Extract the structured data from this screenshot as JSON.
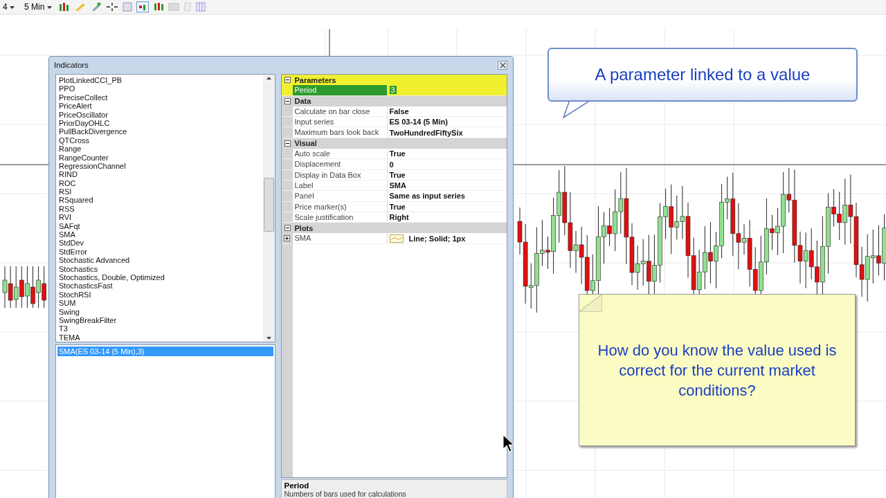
{
  "toolbar": {
    "dropdowns": [
      {
        "label": "4"
      },
      {
        "label": "5 Min"
      }
    ]
  },
  "dialog": {
    "title": "Indicators",
    "indicator_list": [
      "PlotLinkedCCI_PB",
      "PPO",
      "PreciseCollect",
      "PriceAlert",
      "PriceOscillator",
      "PriorDayOHLC",
      "PullBackDivergence",
      "QTCross",
      "Range",
      "RangeCounter",
      "RegressionChannel",
      "RIND",
      "ROC",
      "RSI",
      "RSquared",
      "RSS",
      "RVI",
      "SAFqt",
      "SMA",
      "StdDev",
      "StdError",
      "Stochastic Advanced",
      "Stochastics",
      "Stochastics, Double, Optimized",
      "StochasticsFast",
      "StochRSI",
      "SUM",
      "Swing",
      "SwingBreakFilter",
      "T3",
      "TEMA"
    ],
    "applied": [
      {
        "label": "SMA(ES 03-14 (5 Min),3)",
        "selected": true
      }
    ],
    "property_groups": [
      {
        "name": "Parameters",
        "expanded": true,
        "highlighted": true,
        "rows": [
          {
            "kind": "text",
            "name": "Period",
            "value": "3",
            "selected": true
          }
        ]
      },
      {
        "name": "Data",
        "expanded": true,
        "highlighted": false,
        "rows": [
          {
            "kind": "text",
            "name": "Calculate on bar close",
            "value": "False",
            "selected": false
          },
          {
            "kind": "text",
            "name": "Input series",
            "value": "ES 03-14 (5 Min)",
            "selected": false
          },
          {
            "kind": "text",
            "name": "Maximum bars look back",
            "value": "TwoHundredFiftySix",
            "selected": false
          }
        ]
      },
      {
        "name": "Visual",
        "expanded": true,
        "highlighted": false,
        "rows": [
          {
            "kind": "text",
            "name": "Auto scale",
            "value": "True",
            "selected": false
          },
          {
            "kind": "text",
            "name": "Displacement",
            "value": "0",
            "selected": false
          },
          {
            "kind": "text",
            "name": "Display in Data Box",
            "value": "True",
            "selected": false
          },
          {
            "kind": "text",
            "name": "Label",
            "value": "SMA",
            "selected": false
          },
          {
            "kind": "text",
            "name": "Panel",
            "value": "Same as input series",
            "selected": false
          },
          {
            "kind": "text",
            "name": "Price marker(s)",
            "value": "True",
            "selected": false
          },
          {
            "kind": "text",
            "name": "Scale justification",
            "value": "Right",
            "selected": false
          }
        ]
      },
      {
        "name": "Plots",
        "expanded": true,
        "highlighted": false,
        "rows": [
          {
            "kind": "plot",
            "name": "SMA",
            "value": "Line; Solid; 1px",
            "selected": false
          }
        ]
      }
    ],
    "description": {
      "title": "Period",
      "text": "Numbers of bars used for calculations"
    }
  },
  "callouts": [
    {
      "kind": "speech",
      "text": "A parameter linked to a value"
    },
    {
      "kind": "note",
      "text": "How do you know the value used is correct for the current market conditions?"
    }
  ]
}
